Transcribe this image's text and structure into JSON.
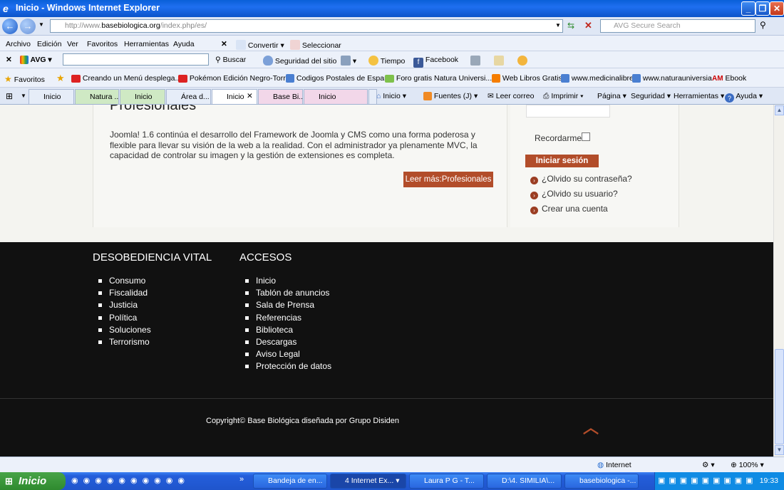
{
  "window": {
    "title": "Inicio - Windows Internet Explorer"
  },
  "address": {
    "url_prefix": "http://www.",
    "url_domain": "basebiologica.org",
    "url_path": "/index.php/es/",
    "search_placeholder": "AVG Secure Search"
  },
  "menu": {
    "items": [
      "Archivo",
      "Edición",
      "Ver",
      "Favoritos",
      "Herramientas",
      "Ayuda"
    ],
    "convertir": "Convertir",
    "seleccionar": "Seleccionar"
  },
  "avg_toolbar": {
    "brand": "AVG",
    "buscar": "Buscar",
    "seguridad": "Seguridad del sitio",
    "tiempo": "Tiempo",
    "facebook": "Facebook"
  },
  "favorites": {
    "label": "Favoritos",
    "items": [
      "Creando un Menú desplega...",
      "Pokémon Edición Negro-Torr...",
      "Codigos Postales de España",
      "Foro gratis  Natura Universi...",
      "Web Libros Gratis",
      "www.medicinalibre",
      "www.naturauniversia",
      "Ebook"
    ]
  },
  "tabs": {
    "items": [
      "Inicio",
      "Natura ...",
      "Inicio",
      "Área d...",
      "Inicio",
      "Base Bi...",
      "Inicio"
    ]
  },
  "commands": {
    "inicio": "Inicio",
    "fuentes": "Fuentes (J)",
    "correo": "Leer correo",
    "imprimir": "Imprimir",
    "pagina": "Página",
    "seguridad": "Seguridad",
    "herramientas": "Herramientas",
    "ayuda": "Ayuda"
  },
  "article": {
    "heading": "Profesionales",
    "body": "Joomla! 1.6 continúa el desarrollo del Framework de Joomla y CMS como una forma poderosa y flexible para llevar su visión de la web a la realidad. Con el administrador ya plenamente MVC, la capacidad de controlar su imagen y la gestión de extensiones es completa.",
    "read_more": "Leer más:Profesionales"
  },
  "login": {
    "remember": "Recordarme",
    "submit": "Iniciar sesión",
    "links": [
      "¿Olvido su contraseña?",
      "¿Olvido su usuario?",
      "Crear una cuenta"
    ]
  },
  "footer": {
    "col1_title": "DESOBEDIENCIA VITAL",
    "col1_items": [
      "Consumo",
      "Fiscalidad",
      "Justicia",
      "Política",
      "Soluciones",
      "Terrorismo"
    ],
    "col2_title": "ACCESOS",
    "col2_items": [
      "Inicio",
      "Tablón de anuncios",
      "Sala de Prensa",
      "Referencias",
      "Biblioteca",
      "Descargas",
      "Aviso Legal",
      "Protección de datos"
    ],
    "copyright": "Copyright©  Base Biológica    diseñada por Grupo Disiden"
  },
  "status": {
    "zone": "Internet",
    "zoom": "100%"
  },
  "taskbar": {
    "start": "Inicio",
    "tasks": [
      "Bandeja de en...",
      "4 Internet Ex...",
      "Laura P G - T...",
      "D:\\4. SIMILIA\\...",
      "basebiologica -..."
    ],
    "clock": "19:33"
  },
  "colors": {
    "accent": "#b24d2a",
    "footer_bg": "#111111",
    "titlebar": "#0a5fd8"
  }
}
